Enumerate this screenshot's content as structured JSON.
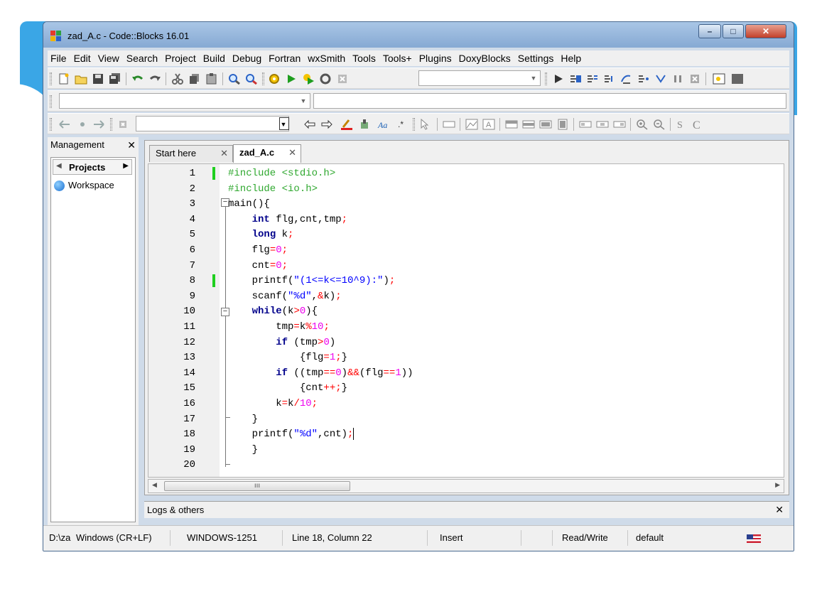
{
  "window": {
    "title": "zad_A.c - Code::Blocks 16.01"
  },
  "menu": [
    "File",
    "Edit",
    "View",
    "Search",
    "Project",
    "Build",
    "Debug",
    "Fortran",
    "wxSmith",
    "Tools",
    "Tools+",
    "Plugins",
    "DoxyBlocks",
    "Settings",
    "Help"
  ],
  "management": {
    "title": "Management",
    "tab": "Projects",
    "workspace": "Workspace"
  },
  "tabs": [
    "Start here",
    "zad_A.c"
  ],
  "code_lines": [
    {
      "n": "1",
      "mark": true
    },
    {
      "n": "2",
      "mark": false
    },
    {
      "n": "3",
      "mark": false
    },
    {
      "n": "4",
      "mark": false
    },
    {
      "n": "5",
      "mark": false
    },
    {
      "n": "6",
      "mark": false
    },
    {
      "n": "7",
      "mark": false
    },
    {
      "n": "8",
      "mark": true
    },
    {
      "n": "9",
      "mark": false
    },
    {
      "n": "10",
      "mark": false
    },
    {
      "n": "11",
      "mark": false
    },
    {
      "n": "12",
      "mark": false
    },
    {
      "n": "13",
      "mark": false
    },
    {
      "n": "14",
      "mark": false
    },
    {
      "n": "15",
      "mark": false
    },
    {
      "n": "16",
      "mark": false
    },
    {
      "n": "17",
      "mark": false
    },
    {
      "n": "18",
      "mark": false
    },
    {
      "n": "19",
      "mark": false
    },
    {
      "n": "20",
      "mark": false
    }
  ],
  "code_text": [
    "#include <stdio.h>",
    "#include <io.h>",
    "main(){",
    "    int flg,cnt,tmp;",
    "    long k;",
    "    flg=0;",
    "    cnt=0;",
    "    printf(\"(1<=k<=10^9):\");",
    "    scanf(\"%d\",&k);",
    "    while(k>0){",
    "        tmp=k%10;",
    "        if (tmp>0)",
    "            {flg=1;}",
    "        if ((tmp==0)&&(flg==1))",
    "            {cnt++;}",
    "        k=k/10;",
    "    }",
    "    printf(\"%d\",cnt);",
    "    }",
    ""
  ],
  "logs": {
    "title": "Logs & others"
  },
  "status": {
    "path": "D:\\za",
    "eol": "Windows (CR+LF)",
    "encoding": "WINDOWS-1251",
    "position": "Line 18, Column 22",
    "mode": "Insert",
    "access": "Read/Write",
    "profile": "default"
  },
  "colors": {
    "keyword": "#00008b",
    "preprocessor": "#2fa82f",
    "number": "#ee00ee",
    "string": "#0000ff",
    "operator": "#ff0000",
    "gutter_mark": "#1fcf1f",
    "frame": "#3aa6e6"
  }
}
